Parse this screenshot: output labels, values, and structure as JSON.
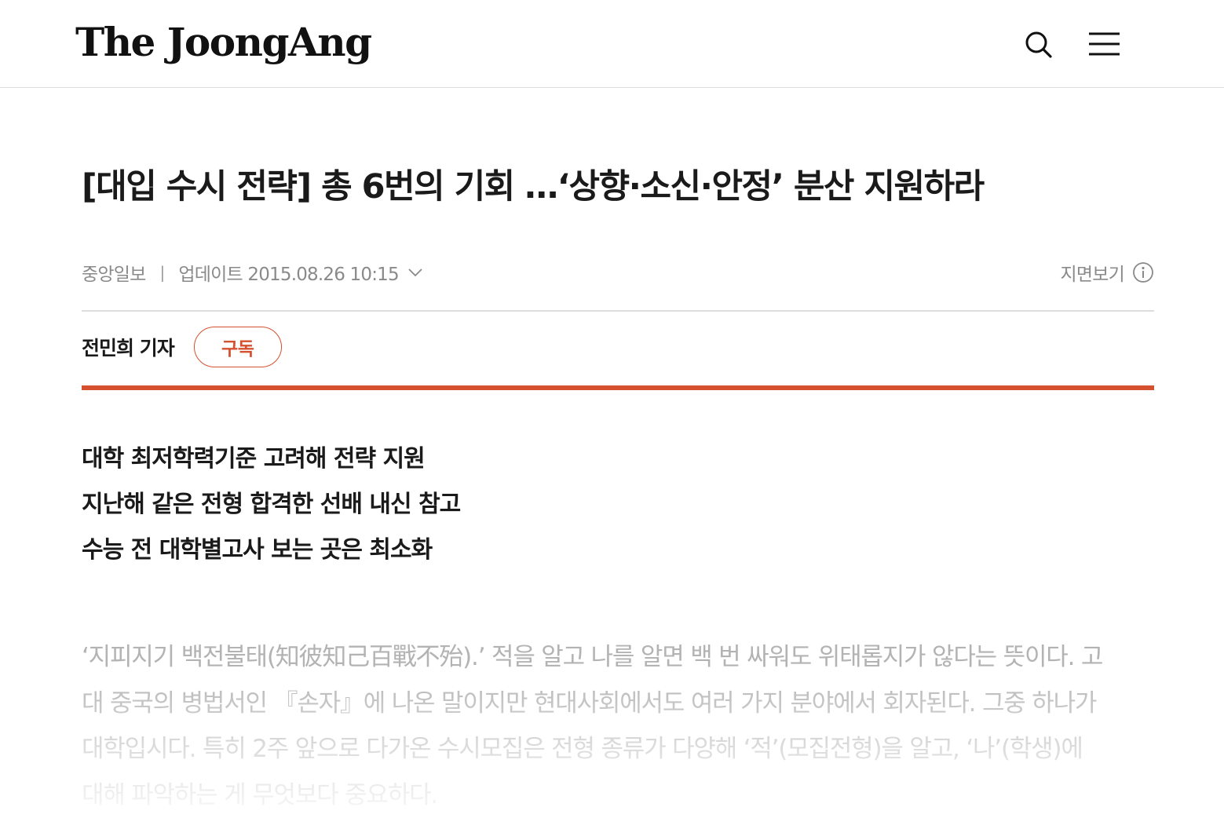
{
  "header": {
    "logo": "The JoongAng",
    "search_icon": "search-icon",
    "menu_icon": "hamburger-menu-icon"
  },
  "article": {
    "headline": "[대입 수시 전략] 총 6번의 기회 …‘상향·소신·안정’ 분산 지원하라",
    "meta": {
      "source": "중앙일보",
      "separator": "|",
      "updated": "업데이트 2015.08.26 10:15",
      "paper_view": "지면보기"
    },
    "byline": {
      "reporter": "전민희 기자",
      "subscribe_label": "구독"
    },
    "subheads": [
      "대학 최저학력기준 고려해 전략 지원",
      "지난해 같은 전형 합격한 선배 내신 참고",
      "수능 전 대학별고사 보는 곳은 최소화"
    ],
    "body": "‘지피지기 백전불태(知彼知己百戰不殆).’ 적을 알고 나를 알면 백 번 싸워도 위태롭지가 않다는 뜻이다. 고대 중국의 병법서인 『손자』에 나온 말이지만 현대사회에서도 여러 가지 분야에서 회자된다. 그중 하나가 대학입시다. 특히 2주 앞으로 다가온 수시모집은 전형 종류가 다양해 ‘적’(모집전형)을 알고, ‘나’(학생)에 대해 파악하는 게 무엇보다 중요하다."
  },
  "colors": {
    "accent": "#d4502e",
    "meta_gray": "#8a8a8a",
    "body_gray": "#b3b3b3"
  }
}
